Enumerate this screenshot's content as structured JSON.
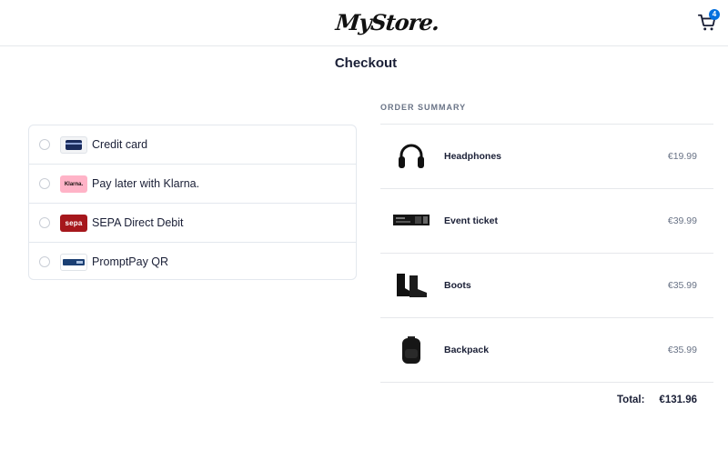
{
  "header": {
    "logo_text": "MyStore.",
    "cart_count": "4"
  },
  "page": {
    "title": "Checkout"
  },
  "payment_methods": [
    {
      "label": "Credit card",
      "icon": "credit-card-icon",
      "selected": false
    },
    {
      "label": "Pay later with Klarna.",
      "icon": "klarna-icon",
      "icon_text": "Klarna.",
      "selected": false
    },
    {
      "label": "SEPA Direct Debit",
      "icon": "sepa-icon",
      "icon_text": "sepa",
      "selected": false
    },
    {
      "label": "PromptPay QR",
      "icon": "promptpay-icon",
      "selected": false
    }
  ],
  "order_summary": {
    "heading": "ORDER SUMMARY",
    "items": [
      {
        "name": "Headphones",
        "price": "€19.99",
        "icon": "headphones-icon"
      },
      {
        "name": "Event ticket",
        "price": "€39.99",
        "icon": "ticket-icon"
      },
      {
        "name": "Boots",
        "price": "€35.99",
        "icon": "boots-icon"
      },
      {
        "name": "Backpack",
        "price": "€35.99",
        "icon": "backpack-icon"
      }
    ],
    "total_label": "Total:",
    "total_value": "€131.96"
  },
  "colors": {
    "accent": "#0570de",
    "text": "#1a1f36",
    "muted": "#697386",
    "border": "#e3e8ee",
    "klarna_pink": "#ffb3c7",
    "sepa_red": "#a6171c"
  }
}
